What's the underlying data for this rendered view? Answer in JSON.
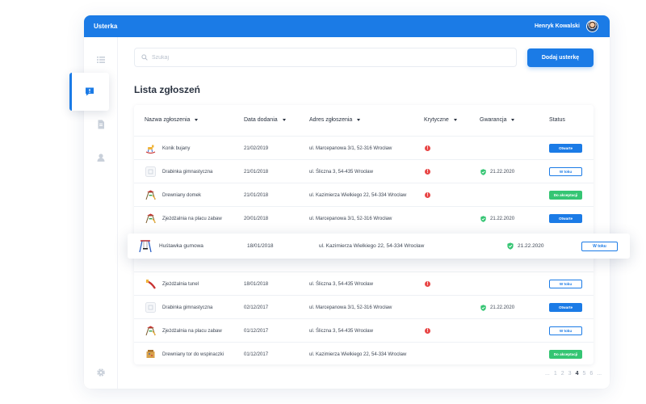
{
  "app": {
    "title": "Usterka"
  },
  "user": {
    "name": "Henryk Kowalski"
  },
  "search": {
    "placeholder": "Szukaj"
  },
  "actions": {
    "add_label": "Dodaj usterkę"
  },
  "page": {
    "title": "Lista zgłoszeń"
  },
  "columns": {
    "name": "Nazwa zgłoszenia",
    "date": "Data dodania",
    "address": "Adres zgłoszenia",
    "critical": "Krytyczne",
    "warranty": "Gwarancja",
    "status": "Status"
  },
  "sidebar": {
    "items": [
      {
        "icon": "list-icon"
      },
      {
        "icon": "report-icon",
        "active": true
      },
      {
        "icon": "document-icon"
      },
      {
        "icon": "user-icon"
      },
      {
        "icon": "gear-icon"
      }
    ]
  },
  "rows": [
    {
      "name": "Konik bujany",
      "date": "21/02/2019",
      "address": "ul. Marcepanowa 3/1, 52-316 Wrocław",
      "critical": true,
      "warranty": "",
      "status": "Otwarte",
      "status_type": "open",
      "thumb": "rocking-horse"
    },
    {
      "name": "Drabinka gimnastyczna",
      "date": "21/01/2018",
      "address": "ul. Śliczna 3, 54-435 Wrocław",
      "critical": true,
      "warranty": "21.22.2020",
      "status": "W toku",
      "status_type": "progress",
      "thumb": "placeholder"
    },
    {
      "name": "Drewniany domek",
      "date": "21/01/2018",
      "address": "ul. Kazimierza Wielkiego 22, 54-334 Wrocław",
      "critical": true,
      "warranty": "",
      "status": "Do akceptacji",
      "status_type": "accept",
      "thumb": "playground"
    },
    {
      "name": "Zjeżdżalnia na placu zabaw",
      "date": "20/01/2018",
      "address": "ul. Marcepanowa 3/1, 52-316 Wrocław",
      "critical": false,
      "warranty": "21.22.2020",
      "status": "Otwarte",
      "status_type": "open",
      "thumb": "playground"
    },
    {
      "name": "Zjeżdżalnia tunel",
      "date": "18/01/2018",
      "address": "ul. Śliczna 3, 54-435 Wrocław",
      "critical": true,
      "warranty": "",
      "status": "W toku",
      "status_type": "progress",
      "thumb": "slide"
    },
    {
      "name": "Drabinka gimnastyczna",
      "date": "02/12/2017",
      "address": "ul. Marcepanowa 3/1, 52-316 Wrocław",
      "critical": false,
      "warranty": "21.22.2020",
      "status": "Otwarte",
      "status_type": "open",
      "thumb": "placeholder"
    },
    {
      "name": "Zjeżdżalnia na placu zabaw",
      "date": "01/12/2017",
      "address": "ul. Śliczna 3, 54-435 Wrocław",
      "critical": true,
      "warranty": "",
      "status": "W toku",
      "status_type": "progress",
      "thumb": "playground"
    },
    {
      "name": "Drewniany tor do wspinaczki",
      "date": "01/12/2017",
      "address": "ul. Kazimierza Wielkiego 22, 54-334 Wrocław",
      "critical": false,
      "warranty": "",
      "status": "Do akceptacji",
      "status_type": "accept",
      "thumb": "climbing"
    }
  ],
  "highlighted_row": {
    "name": "Huśtawka gumowa",
    "date": "18/01/2018",
    "address": "ul. Kazimierza Wielkiego 22, 54-334 Wrocław",
    "warranty": "21.22.2020",
    "status": "W toku",
    "thumb": "swing"
  },
  "pagination": {
    "pages": [
      "...",
      "1",
      "2",
      "3",
      "4",
      "5",
      "6",
      "..."
    ],
    "current": "4"
  },
  "colors": {
    "primary": "#1b7be6",
    "critical": "#e84545",
    "success": "#35c573"
  }
}
